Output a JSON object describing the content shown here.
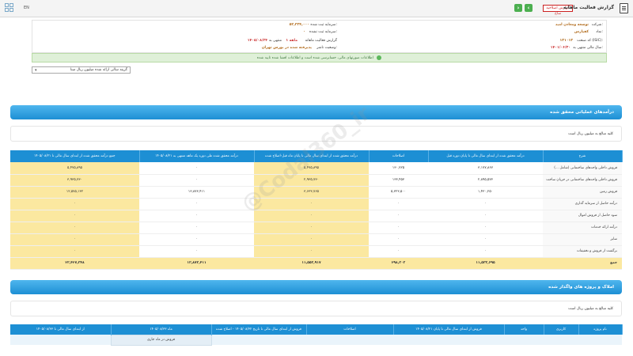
{
  "topbar": {
    "report_title": "گزارش فعالیت ماهانه",
    "badge": "گزارش اصلاحیه ساخ",
    "page_label": "EN",
    "prev": "›",
    "next": "‹"
  },
  "header": {
    "company_label": "شرکت:",
    "company_value": "توسعه ومعادن امید",
    "symbol_label": "نماد:",
    "symbol_value": "کفپارس",
    "isic_label": "کد صنعت (ISIC):",
    "isic_value": "۱۳۱۰۱۳",
    "fiscal_label": "سال مالی منتهی به:",
    "fiscal_value": "۱۴۰۱/۰۶/۳۰",
    "capital_label": "سرمایه ثبت شده:",
    "capital_value": "۵۲,۲۲۴,۰۰۰",
    "unregistered_label": "سرمایه ثبت نشده:",
    "unregistered_value": "۰",
    "report_label": "گزارش فعالیت ماهانه",
    "period_value": "۱ ماهه",
    "ending_label": "منتهی به",
    "ending_value": "۱۴۰۵/۰۸/۲۴",
    "status_label": "وضعیت ناشر:",
    "status_value": "پذیرفته شده در بورس تهران"
  },
  "message": "اطلاعات صورتهای مالی، حسابرسی شده است و اطلاعات افشا شده تایید شده",
  "select": {
    "value": "گزینه سالی ارائه شده میلیون ریال مبنا"
  },
  "section1": {
    "title": "درآمدهای عملیاتی محقق شده",
    "note": "کلیه مبالغ به میلیون ریال است"
  },
  "table1": {
    "headers": [
      "شرح",
      "درآمد محقق شده از ابتدای سال مالی تا پایان دوره قبل",
      "اصلاحات",
      "درآمد محقق شده از ابتدای سال مالی تا پایان ماه قبل-اصلاح شده",
      "درآمد محقق شده طی دوره یک ماهه منتهی به ۱۴۰۵/۰۸/۲۱",
      "جمع درآمد محقق شده از ابتدای سال مالی تا ۱۴۰۵/۰۸/۲۱"
    ],
    "rows": [
      [
        "فروش داخلی واحدهای ساختمانی (شامل ...)",
        "۳,۱۷۷,۸۶۷",
        "۱۳۰,۷۲۵",
        "۵,۴۷۵,۸۹۵",
        "۰",
        "۵,۴۷۵,۸۹۵"
      ],
      [
        "فروش داخلی واحدهای ساختمانی در جریان ساخت",
        "۲,۸۹۵,۵۷۳",
        "۱۳۳,۴۵۳",
        "۲,۹۳۵,۷۳۰",
        "۰",
        "۳,۹۳۵,۷۳۰"
      ],
      [
        "فروش زمین",
        "۱,۴۳۰,۲۵۰",
        "۵,۳۲۳,۵۰۰",
        "۳,۶۳۳,۷۶۵",
        "۱۳,۸۷۳,۴۱۱",
        "۱۲,۵۷۵,۱۳۲"
      ],
      [
        "درآمد حاصل از سرمایه گذاری",
        "۰",
        "۰",
        "۰",
        "۰",
        "۰"
      ],
      [
        "سود حاصل از فروش اموال",
        "۰",
        "۰",
        "۰",
        "۰",
        "۰"
      ],
      [
        "درآمد ارائه خدمات",
        "۰",
        "۰",
        "۰",
        "۰",
        "۰"
      ],
      [
        "سایر",
        "۰",
        "۰",
        "۰",
        "۰",
        "۰"
      ],
      [
        "برگشت از فروش و تخفیفات",
        "۰",
        "۰",
        "۰",
        "۰",
        "۰"
      ]
    ],
    "total": [
      "جمع",
      "۱۱,۵۳۳,۶۹۵",
      "۲۹۸,۳۰۳",
      "۱۱,۵۵۳,۹۱۷",
      "۱۳,۸۷۳,۴۱۱",
      "۲۳,۴۲۷,۳۴۸"
    ]
  },
  "section2": {
    "title": "املاک و پروژه های واگذار شده",
    "note": "کلیه مبالغ به میلیون ریال است"
  },
  "table2": {
    "headers": [
      "نام پروژه",
      "کاربری",
      "واحد",
      "فروش از ابتدای سال مالی تا پایان ۱۴۰۵/۰۸/۲۱",
      "اصلاحات",
      "فروش از ابتدای سال مالی تا تاریخ ۱۴۰۵/۰۸/۳۲ - اصلاح شده",
      "ماه ۱۴۰۵/۰۸/۳۳",
      "از ابتدای سال مالی تا ۱۴۰۵/۰۸/۳۳"
    ],
    "subheader": "فروش در ماه جاری"
  },
  "watermark": "@Codal360_ir",
  "colors": {
    "accent": "#1d8fd4",
    "highlight": "#fbe8a0",
    "success": "#dff0d8"
  }
}
